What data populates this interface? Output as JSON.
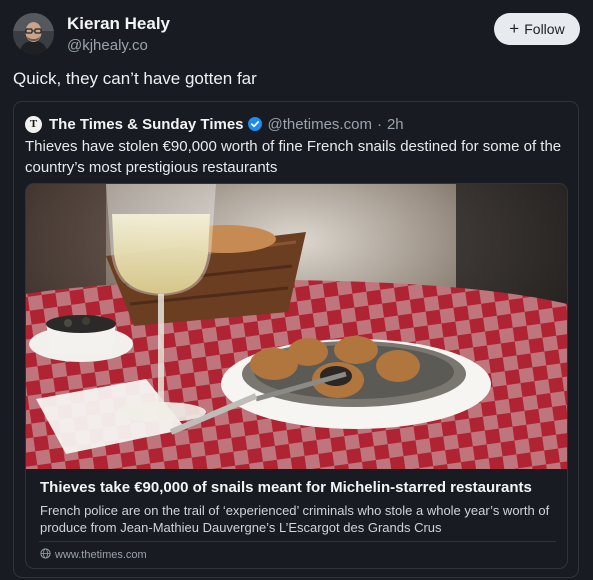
{
  "author": {
    "name": "Kieran Healy",
    "handle": "@kjhealy.co"
  },
  "follow": {
    "label": "Follow"
  },
  "post": {
    "text": "Quick, they can’t have gotten far"
  },
  "quote": {
    "publisher": "The Times & Sunday Times",
    "handle": "@thetimes.com",
    "separator": "·",
    "time": "2h",
    "logo_letter": "T",
    "text": "Thieves have stolen €90,000 worth of fine French snails destined for some of the country’s most prestigious restaurants",
    "link": {
      "title": "Thieves take €90,000 of snails meant for Michelin-starred restaurants",
      "description": "French police are on the trail of ‘experienced’ criminals who stole a whole year’s worth of produce from Jean-Mathieu Dauvergne’s L’Escargot des Grands Crus",
      "domain": "www.thetimes.com"
    }
  },
  "colors": {
    "background": "#181b22",
    "verified": "#1d8bf0",
    "tablecloth_red": "#c8283a"
  },
  "icons": [
    "avatar-photo",
    "plus-icon",
    "publisher-logo",
    "verified-badge-icon",
    "globe-icon"
  ]
}
